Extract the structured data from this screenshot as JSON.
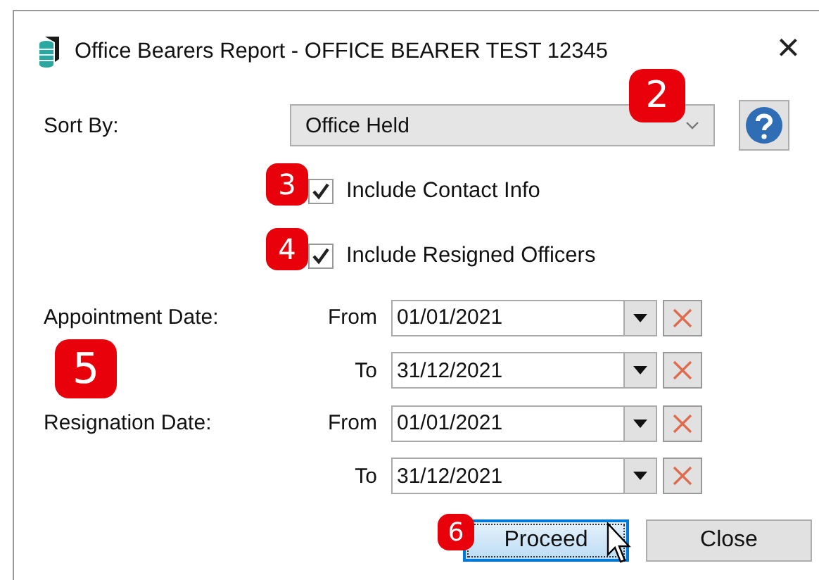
{
  "window": {
    "title": "Office Bearers Report - OFFICE BEARER TEST 12345",
    "close": "×"
  },
  "sort_by": {
    "label": "Sort By:",
    "value": "Office Held",
    "badge": "2"
  },
  "options": [
    {
      "label": "Include Contact Info",
      "checked": true,
      "badge": "3"
    },
    {
      "label": "Include Resigned Officers",
      "checked": true,
      "badge": "4"
    }
  ],
  "dates_badge": "5",
  "date_ranges": [
    {
      "label": "Appointment Date:",
      "from_label": "From",
      "from": "01/01/2021",
      "to_label": "To",
      "to": "31/12/2021"
    },
    {
      "label": "Resignation Date:",
      "from_label": "From",
      "from": "01/01/2021",
      "to_label": "To",
      "to": "31/12/2021"
    }
  ],
  "buttons": [
    {
      "label": "Proceed",
      "default": true,
      "badge": "6"
    },
    {
      "label": "Close",
      "default": false
    }
  ]
}
